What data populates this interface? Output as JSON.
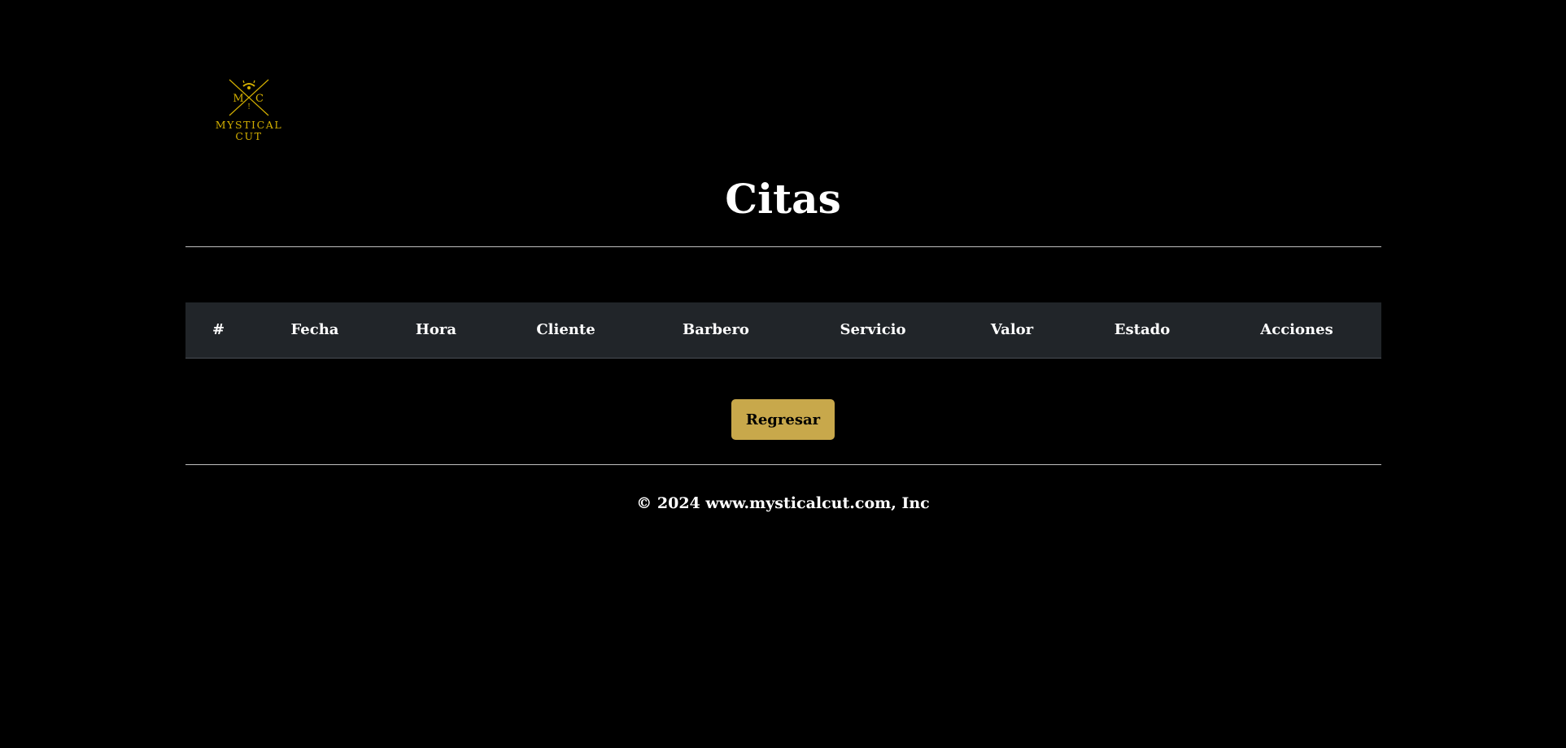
{
  "logo": {
    "monogram_left": "M",
    "monogram_right": "C",
    "brand_line1": "MYSTICAL",
    "brand_line2": "CUT",
    "color": "#d4b000"
  },
  "page_title": "Citas",
  "table": {
    "columns": [
      "#",
      "Fecha",
      "Hora",
      "Cliente",
      "Barbero",
      "Servicio",
      "Valor",
      "Estado",
      "Acciones"
    ],
    "rows": []
  },
  "back_button": {
    "label": "Regresar",
    "color": "#c8a84b"
  },
  "footer": {
    "text": "© 2024 www.mysticalcut.com, Inc"
  }
}
